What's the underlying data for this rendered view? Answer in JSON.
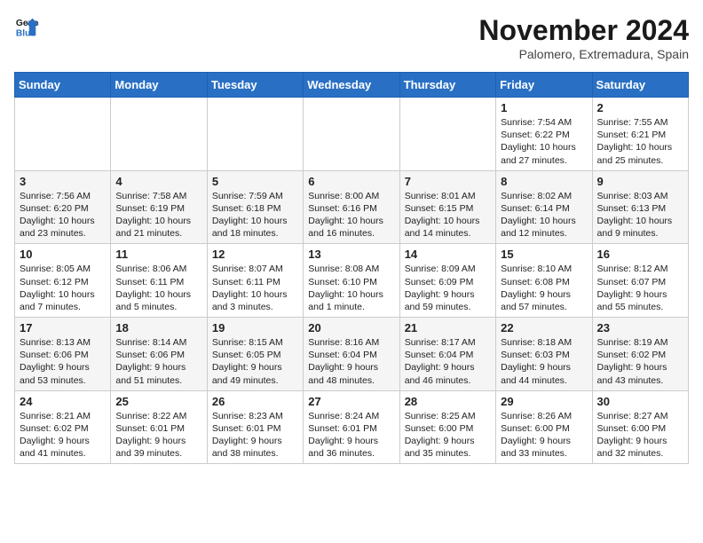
{
  "header": {
    "logo_line1": "General",
    "logo_line2": "Blue",
    "month_title": "November 2024",
    "location": "Palomero, Extremadura, Spain"
  },
  "days_of_week": [
    "Sunday",
    "Monday",
    "Tuesday",
    "Wednesday",
    "Thursday",
    "Friday",
    "Saturday"
  ],
  "weeks": [
    [
      {
        "day": "",
        "content": ""
      },
      {
        "day": "",
        "content": ""
      },
      {
        "day": "",
        "content": ""
      },
      {
        "day": "",
        "content": ""
      },
      {
        "day": "",
        "content": ""
      },
      {
        "day": "1",
        "content": "Sunrise: 7:54 AM\nSunset: 6:22 PM\nDaylight: 10 hours and 27 minutes."
      },
      {
        "day": "2",
        "content": "Sunrise: 7:55 AM\nSunset: 6:21 PM\nDaylight: 10 hours and 25 minutes."
      }
    ],
    [
      {
        "day": "3",
        "content": "Sunrise: 7:56 AM\nSunset: 6:20 PM\nDaylight: 10 hours and 23 minutes."
      },
      {
        "day": "4",
        "content": "Sunrise: 7:58 AM\nSunset: 6:19 PM\nDaylight: 10 hours and 21 minutes."
      },
      {
        "day": "5",
        "content": "Sunrise: 7:59 AM\nSunset: 6:18 PM\nDaylight: 10 hours and 18 minutes."
      },
      {
        "day": "6",
        "content": "Sunrise: 8:00 AM\nSunset: 6:16 PM\nDaylight: 10 hours and 16 minutes."
      },
      {
        "day": "7",
        "content": "Sunrise: 8:01 AM\nSunset: 6:15 PM\nDaylight: 10 hours and 14 minutes."
      },
      {
        "day": "8",
        "content": "Sunrise: 8:02 AM\nSunset: 6:14 PM\nDaylight: 10 hours and 12 minutes."
      },
      {
        "day": "9",
        "content": "Sunrise: 8:03 AM\nSunset: 6:13 PM\nDaylight: 10 hours and 9 minutes."
      }
    ],
    [
      {
        "day": "10",
        "content": "Sunrise: 8:05 AM\nSunset: 6:12 PM\nDaylight: 10 hours and 7 minutes."
      },
      {
        "day": "11",
        "content": "Sunrise: 8:06 AM\nSunset: 6:11 PM\nDaylight: 10 hours and 5 minutes."
      },
      {
        "day": "12",
        "content": "Sunrise: 8:07 AM\nSunset: 6:11 PM\nDaylight: 10 hours and 3 minutes."
      },
      {
        "day": "13",
        "content": "Sunrise: 8:08 AM\nSunset: 6:10 PM\nDaylight: 10 hours and 1 minute."
      },
      {
        "day": "14",
        "content": "Sunrise: 8:09 AM\nSunset: 6:09 PM\nDaylight: 9 hours and 59 minutes."
      },
      {
        "day": "15",
        "content": "Sunrise: 8:10 AM\nSunset: 6:08 PM\nDaylight: 9 hours and 57 minutes."
      },
      {
        "day": "16",
        "content": "Sunrise: 8:12 AM\nSunset: 6:07 PM\nDaylight: 9 hours and 55 minutes."
      }
    ],
    [
      {
        "day": "17",
        "content": "Sunrise: 8:13 AM\nSunset: 6:06 PM\nDaylight: 9 hours and 53 minutes."
      },
      {
        "day": "18",
        "content": "Sunrise: 8:14 AM\nSunset: 6:06 PM\nDaylight: 9 hours and 51 minutes."
      },
      {
        "day": "19",
        "content": "Sunrise: 8:15 AM\nSunset: 6:05 PM\nDaylight: 9 hours and 49 minutes."
      },
      {
        "day": "20",
        "content": "Sunrise: 8:16 AM\nSunset: 6:04 PM\nDaylight: 9 hours and 48 minutes."
      },
      {
        "day": "21",
        "content": "Sunrise: 8:17 AM\nSunset: 6:04 PM\nDaylight: 9 hours and 46 minutes."
      },
      {
        "day": "22",
        "content": "Sunrise: 8:18 AM\nSunset: 6:03 PM\nDaylight: 9 hours and 44 minutes."
      },
      {
        "day": "23",
        "content": "Sunrise: 8:19 AM\nSunset: 6:02 PM\nDaylight: 9 hours and 43 minutes."
      }
    ],
    [
      {
        "day": "24",
        "content": "Sunrise: 8:21 AM\nSunset: 6:02 PM\nDaylight: 9 hours and 41 minutes."
      },
      {
        "day": "25",
        "content": "Sunrise: 8:22 AM\nSunset: 6:01 PM\nDaylight: 9 hours and 39 minutes."
      },
      {
        "day": "26",
        "content": "Sunrise: 8:23 AM\nSunset: 6:01 PM\nDaylight: 9 hours and 38 minutes."
      },
      {
        "day": "27",
        "content": "Sunrise: 8:24 AM\nSunset: 6:01 PM\nDaylight: 9 hours and 36 minutes."
      },
      {
        "day": "28",
        "content": "Sunrise: 8:25 AM\nSunset: 6:00 PM\nDaylight: 9 hours and 35 minutes."
      },
      {
        "day": "29",
        "content": "Sunrise: 8:26 AM\nSunset: 6:00 PM\nDaylight: 9 hours and 33 minutes."
      },
      {
        "day": "30",
        "content": "Sunrise: 8:27 AM\nSunset: 6:00 PM\nDaylight: 9 hours and 32 minutes."
      }
    ]
  ]
}
